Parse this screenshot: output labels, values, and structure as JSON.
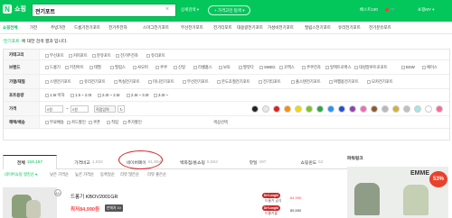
{
  "header": {
    "logo_letter": "N",
    "logo_text": "쇼핑",
    "search_value": "전기포트",
    "dropdown": "상세검색 ▾",
    "ai_button": "+ 가격고민 탐색 ▾",
    "points": "베스트100",
    "cart": "장바구니",
    "user": "쇼핑MY ▾"
  },
  "nav": [
    {
      "label": "쇼핑전체",
      "active": true
    },
    {
      "label": "가전"
    },
    {
      "label": "주방가전"
    },
    {
      "label": "드롱기전기포트"
    },
    {
      "label": "전기주전자"
    },
    {
      "label": "스마그전기포트"
    },
    {
      "label": "무선전기포트"
    },
    {
      "label": "전기티포트"
    },
    {
      "label": "대용량전기포트"
    },
    {
      "label": "가성비전기포트"
    },
    {
      "label": "필립스전기포트"
    },
    {
      "label": "유리전기포트"
    },
    {
      "label": "전기분유포트"
    }
  ],
  "result_line": {
    "query": "'전기포트'",
    "suffix": " 에 대한 검색 결과 입니다."
  },
  "filters": {
    "category": {
      "label": "카테고리",
      "options": [
        "무선포트",
        "커피포트",
        "분유포트",
        "전기주전자",
        "유리포트"
      ]
    },
    "brand": {
      "label": "브랜드",
      "options": [
        "드롱기",
        "키친아트",
        "테팔",
        "필립스",
        "샤오미",
        "쿠쿠",
        "신일",
        "러셀홉스",
        "보토",
        "발뮤다",
        "SMEG",
        "코멕스",
        "쿠쿠전자",
        "일렉트로룩스",
        "대성알루트로포트",
        "BSW",
        "에이스"
      ]
    },
    "type": {
      "label": "가열/재질",
      "options": [
        "스텐전기포트",
        "유리전기포트",
        "특실전기포트",
        "미니전기포트",
        "무선전기포트",
        "온도조절전기포트",
        "전기티포트",
        "홈스탠전기포트",
        "여행용전기포트",
        "모카전기포트"
      ]
    },
    "capacity": {
      "label": "포트용량",
      "options": [
        "1.5ℓ 이하",
        "1.5 ~ 2.0ℓ",
        "2.0ℓ ~ 2.5ℓ",
        "2.5ℓ ~ 3.0ℓ",
        "3.0ℓ ~"
      ]
    },
    "price": {
      "label": "가격",
      "min": "0원",
      "max": "0원",
      "button": "직접입력",
      "go": "↻"
    },
    "benefit": {
      "label": "혜택/배송",
      "options": [
        "무료배송",
        "카드할인",
        "쿠폰",
        "적립",
        "추가할인"
      ],
      "color_label": "색상선택"
    },
    "colors": [
      "#222222",
      "#e8e8e8",
      "#e02020",
      "#ff8c00",
      "#f5d800",
      "#7bc618",
      "#27a844",
      "#2095f2",
      "#1f4fd6",
      "#8e44ad",
      "#f06bb1",
      "#8b5a2b",
      "#b8b8b8",
      "#d4af37",
      "#c0c0c0",
      "#a5e6e6",
      "#ffffff",
      "#ff6699"
    ]
  },
  "tabs": [
    {
      "label": "전체",
      "count": "159,167",
      "active": true
    },
    {
      "label": "가격비교",
      "count": "1,832"
    },
    {
      "label": "네이버페이",
      "count": "81,994"
    },
    {
      "label": "백화점/홈쇼핑",
      "count": "5,552"
    },
    {
      "label": "핫딜",
      "count": "497"
    },
    {
      "label": "쇼핑윈도",
      "count": "52"
    }
  ],
  "sort": [
    "네이버쇼핑 랭킹순 ▾",
    "낮은 가격순",
    "높은 가격순",
    "등록일순",
    "리뷰 많은순",
    "리뷰 좋은순"
  ],
  "product": {
    "ad": "AD",
    "title": "드롱기 KBOV2001GR",
    "price": "최저84,990원",
    "compare": "판매처 10",
    "sellers": [
      {
        "logo": "De'Longhi",
        "name": "드롱기 공식",
        "price": "84,990"
      },
      {
        "logo": "De'Longhi",
        "name": "드롱기몰",
        "price": "85,550"
      }
    ]
  },
  "side": {
    "title": "파워링크",
    "badge": "53%",
    "brand": "EMME"
  }
}
